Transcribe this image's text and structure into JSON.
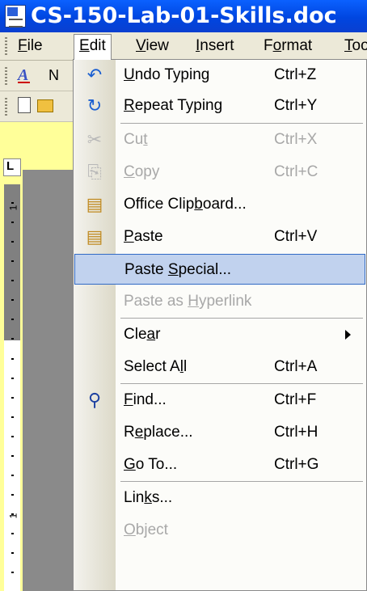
{
  "window": {
    "title": "CS-150-Lab-01-Skills.doc"
  },
  "menubar": {
    "items": [
      {
        "key": "file",
        "label": "File",
        "ul": "F",
        "rest": "ile"
      },
      {
        "key": "edit",
        "label": "Edit",
        "ul": "E",
        "rest": "dit"
      },
      {
        "key": "view",
        "label": "View",
        "ul": "V",
        "rest": "iew"
      },
      {
        "key": "insert",
        "label": "Insert",
        "ul": "I",
        "rest": "nsert"
      },
      {
        "key": "format",
        "label": "Format",
        "pre": "F",
        "ul": "o",
        "rest": "rmat"
      },
      {
        "key": "tools",
        "label": "Tools",
        "ul": "T",
        "rest": "ools"
      }
    ]
  },
  "toolbar": {
    "styles_clip_text": "N"
  },
  "ruler": {
    "corner_label": "L",
    "mark_1": "1",
    "mark_2": "1"
  },
  "edit_menu": {
    "items": [
      {
        "pre": "",
        "ul": "U",
        "post": "ndo Typing",
        "shortcut": "Ctrl+Z",
        "icon": "↶",
        "icon_color": "#1b5fd1"
      },
      {
        "pre": "",
        "ul": "R",
        "post": "epeat Typing",
        "shortcut": "Ctrl+Y",
        "icon": "↻",
        "icon_color": "#1b5fd1"
      },
      {
        "pre": "Cu",
        "ul": "t",
        "post": "",
        "shortcut": "Ctrl+X",
        "icon": "✂"
      },
      {
        "pre": "",
        "ul": "C",
        "post": "opy",
        "shortcut": "Ctrl+C",
        "icon": "⎘"
      },
      {
        "pre": "Office Clip",
        "ul": "b",
        "post": "oard...",
        "shortcut": "",
        "icon": "▤",
        "icon_color": "#c08a20"
      },
      {
        "pre": "",
        "ul": "P",
        "post": "aste",
        "shortcut": "Ctrl+V",
        "icon": "▤",
        "icon_color": "#c08a20"
      },
      {
        "pre": "Paste ",
        "ul": "S",
        "post": "pecial...",
        "shortcut": "",
        "icon": ""
      },
      {
        "pre": "Paste as ",
        "ul": "H",
        "post": "yperlink",
        "shortcut": "",
        "icon": ""
      },
      {
        "pre": "Cle",
        "ul": "a",
        "post": "r",
        "shortcut": "",
        "icon": ""
      },
      {
        "pre": "Select A",
        "ul": "l",
        "post": "l",
        "shortcut": "Ctrl+A",
        "icon": ""
      },
      {
        "pre": "",
        "ul": "F",
        "post": "ind...",
        "shortcut": "Ctrl+F",
        "icon": "⚲",
        "icon_color": "#1b3fa0"
      },
      {
        "pre": "R",
        "ul": "e",
        "post": "place...",
        "shortcut": "Ctrl+H",
        "icon": ""
      },
      {
        "pre": "",
        "ul": "G",
        "post": "o To...",
        "shortcut": "Ctrl+G",
        "icon": ""
      },
      {
        "pre": "Lin",
        "ul": "k",
        "post": "s...",
        "shortcut": "",
        "icon": ""
      },
      {
        "pre": "",
        "ul": "O",
        "post": "bject",
        "shortcut": "",
        "icon": ""
      }
    ]
  },
  "colors": {
    "title_blue": "#0046e0",
    "highlight": "#c1d2ee",
    "highlight_border": "#316ac5",
    "menu_bg": "#ece9d8"
  }
}
